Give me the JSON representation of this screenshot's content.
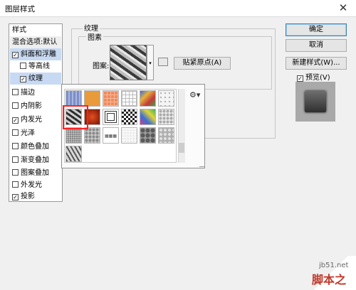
{
  "window": {
    "title": "图层样式",
    "close_icon": "close-icon"
  },
  "styles_panel": {
    "header": "样式",
    "items": [
      {
        "label": "混合选项:默认",
        "has_checkbox": false,
        "checked": false,
        "selected": false,
        "indent": false
      },
      {
        "label": "斜面和浮雕",
        "has_checkbox": true,
        "checked": true,
        "selected": true,
        "indent": false
      },
      {
        "label": "等高线",
        "has_checkbox": true,
        "checked": false,
        "selected": false,
        "indent": true
      },
      {
        "label": "纹理",
        "has_checkbox": true,
        "checked": true,
        "selected": true,
        "indent": true
      },
      {
        "label": "描边",
        "has_checkbox": true,
        "checked": false,
        "selected": false,
        "indent": false
      },
      {
        "label": "内阴影",
        "has_checkbox": true,
        "checked": false,
        "selected": false,
        "indent": false
      },
      {
        "label": "内发光",
        "has_checkbox": true,
        "checked": true,
        "selected": false,
        "indent": false
      },
      {
        "label": "光泽",
        "has_checkbox": true,
        "checked": false,
        "selected": false,
        "indent": false
      },
      {
        "label": "颜色叠加",
        "has_checkbox": true,
        "checked": false,
        "selected": false,
        "indent": false
      },
      {
        "label": "渐变叠加",
        "has_checkbox": true,
        "checked": false,
        "selected": false,
        "indent": false
      },
      {
        "label": "图案叠加",
        "has_checkbox": true,
        "checked": false,
        "selected": false,
        "indent": false
      },
      {
        "label": "外发光",
        "has_checkbox": true,
        "checked": false,
        "selected": false,
        "indent": false
      },
      {
        "label": "投影",
        "has_checkbox": true,
        "checked": true,
        "selected": false,
        "indent": false
      }
    ]
  },
  "texture": {
    "section_title": "纹理",
    "group_title": "图素",
    "pattern_label": "图案:",
    "snap_button": "贴紧原点(A)"
  },
  "pattern_picker": {
    "gear_icon": "gear-icon",
    "tiles": [
      "blue-lines",
      "orange",
      "salmon-grid",
      "white-grid",
      "colorful-cubes",
      "sketch",
      "gray-stones",
      "red-fire",
      "square-target",
      "checker",
      "rainbow-mosaic",
      "white-pebbles",
      "gray-noise",
      "gray-foam",
      "gray-texture-small",
      "white-paper",
      "gray-rocks",
      "gray-mottle",
      "gray-marble"
    ]
  },
  "buttons": {
    "ok": "确定",
    "cancel": "取消",
    "new_style": "新建样式(W)...",
    "preview_label": "预览(V)",
    "preview_checked": true
  },
  "watermark": {
    "site": "jb51.net",
    "name": "脚本之家"
  },
  "colors": {
    "selection": "#c8daf3",
    "highlight_box": "#ff2020",
    "accent": "#3c7fb1"
  }
}
